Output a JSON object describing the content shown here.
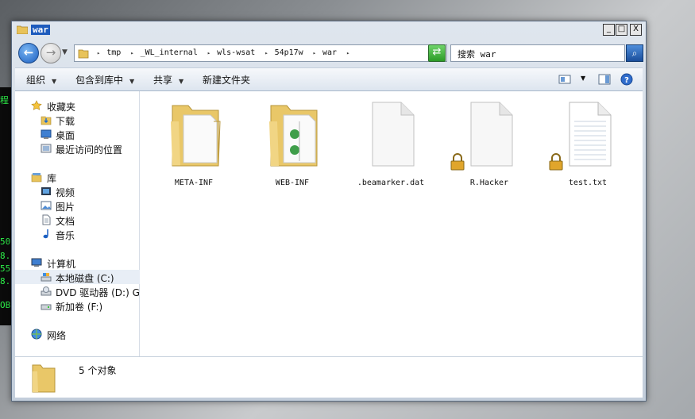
{
  "terminal": {
    "lines": [
      "程",
      "50",
      "8.",
      "55",
      "8.",
      "OB"
    ]
  },
  "window": {
    "title": "war",
    "controls": {
      "minimize": "_",
      "maximize": "□",
      "close": "X"
    }
  },
  "nav": {
    "back_glyph": "←",
    "forward_glyph": "→"
  },
  "breadcrumbs": [
    "tmp",
    "_WL_internal",
    "wls-wsat",
    "54p17w",
    "war"
  ],
  "search": {
    "placeholder": "搜索 war"
  },
  "toolbar": {
    "organize": "组织",
    "include_in_library": "包含到库中",
    "share": "共享",
    "new_folder": "新建文件夹"
  },
  "sidebar": {
    "favorites_header": "收藏夹",
    "favorites": [
      "下载",
      "桌面",
      "最近访问的位置"
    ],
    "libraries_header": "库",
    "libraries": [
      "视频",
      "图片",
      "文档",
      "音乐"
    ],
    "computer_header": "计算机",
    "computer": [
      "本地磁盘 (C:)",
      "DVD 驱动器 (D:) GF",
      "新加卷 (F:)"
    ],
    "network_header": "网络"
  },
  "files": [
    {
      "name": "META-INF",
      "type": "folder-icon",
      "locked": false
    },
    {
      "name": "WEB-INF",
      "type": "folder-icon",
      "locked": false
    },
    {
      "name": ".beamarker.dat",
      "type": "file-icon",
      "locked": false
    },
    {
      "name": "R.Hacker",
      "type": "file-icon",
      "locked": true
    },
    {
      "name": "test.txt",
      "type": "text-file-icon",
      "locked": true
    }
  ],
  "details": {
    "count_text": "5 个对象"
  }
}
